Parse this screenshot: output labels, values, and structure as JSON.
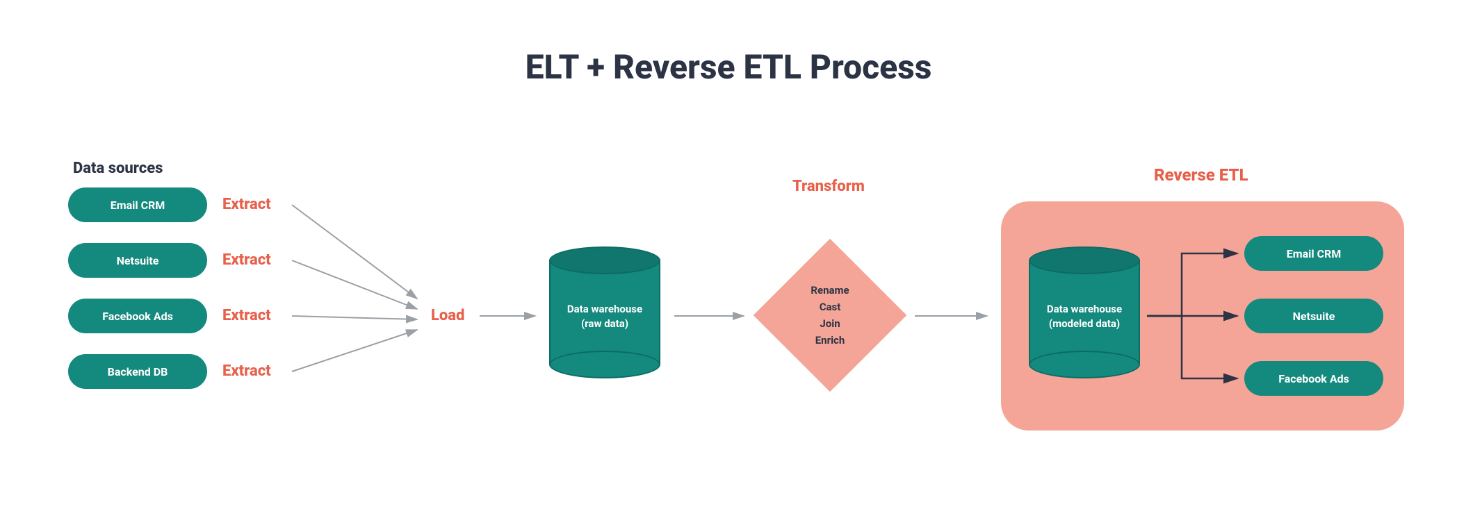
{
  "title": "ELT + Reverse ETL Process",
  "sources_header": "Data sources",
  "sources": {
    "s1": "Email CRM",
    "s2": "Netsuite",
    "s3": "Facebook Ads",
    "s4": "Backend DB"
  },
  "extract_label": "Extract",
  "load_label": "Load",
  "warehouse_raw_line1": "Data warehouse",
  "warehouse_raw_line2": "(raw data)",
  "transform_label": "Transform",
  "transform_ops": {
    "op1": "Rename",
    "op2": "Cast",
    "op3": "Join",
    "op4": "Enrich"
  },
  "reverse_label": "Reverse ETL",
  "warehouse_mod_line1": "Data warehouse",
  "warehouse_mod_line2": "(modeled data)",
  "destinations": {
    "d1": "Email CRM",
    "d2": "Netsuite",
    "d3": "Facebook Ads"
  }
}
